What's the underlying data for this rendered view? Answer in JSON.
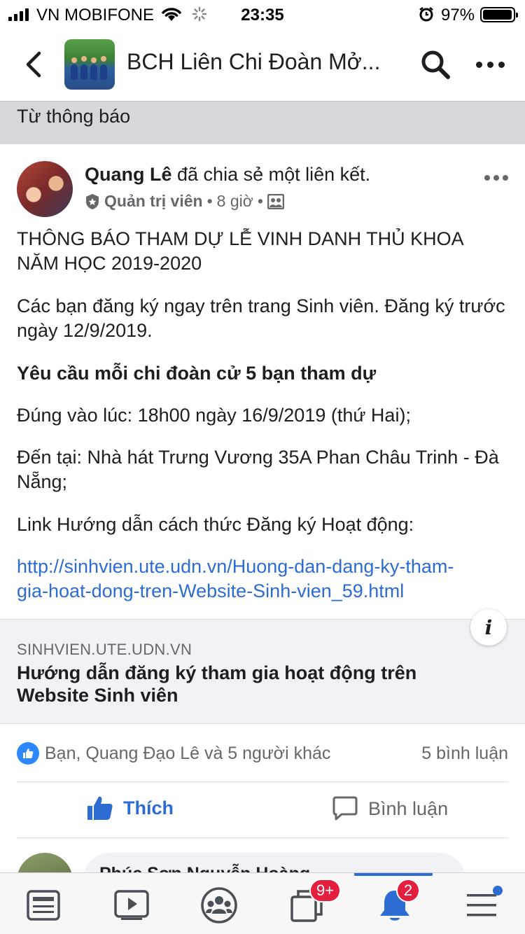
{
  "status_bar": {
    "carrier": "VN MOBIFONE",
    "time": "23:35",
    "battery": "97%",
    "battery_level": 0.97
  },
  "header": {
    "group_name": "BCH Liên Chi Đoàn Mở...",
    "search_icon": "search-icon",
    "more_icon": "more-icon"
  },
  "section_banner": "Từ thông báo",
  "post": {
    "author": "Quang Lê",
    "action": " đã chia sẻ một liên kết.",
    "role": "Quản trị viên",
    "sep1": "•",
    "time": "8 giờ",
    "sep2": "•",
    "lines": {
      "p1": "THÔNG BÁO THAM DỰ LỄ VINH DANH THỦ KHOA NĂM HỌC 2019-2020",
      "p2": "Các bạn đăng ký ngay trên trang Sinh viên. Đăng ký trước ngày 12/9/2019.",
      "p3": "Yêu cầu mỗi chi đoàn cử 5 bạn tham dự",
      "p4": "Đúng vào lúc: 18h00 ngày 16/9/2019 (thứ Hai);",
      "p5": "Đến tại: Nhà hát Trưng Vương 35A Phan Châu Trinh - Đà Nẵng;",
      "p6": "Link Hướng dẫn cách thức Đăng ký Hoạt động:",
      "url_line1": "http://sinhvien.ute.udn.vn/Huong-dan-dang-ky-tham-",
      "url_line2": "gia-hoat-dong-tren-Website-Sinh-vien_59.html"
    }
  },
  "link_preview": {
    "domain": "SINHVIEN.UTE.UDN.VN",
    "title": "Hướng dẫn đăng ký tham gia hoạt động trên Website Sinh viên",
    "info_glyph": "i"
  },
  "reactions": {
    "names": "Bạn, Quang Đạo Lê và 5 người khác",
    "comments": "5 bình luận"
  },
  "actions": {
    "like": "Thích",
    "comment": "Bình luận"
  },
  "comment_preview": {
    "author": "Phúc Sơn Nguyễn Hoàng"
  },
  "tabbar": {
    "groups_badge": "9+",
    "notifications_badge": "2"
  },
  "colors": {
    "accent": "#2d6cd2",
    "badge": "#e41e3f",
    "banner": "#d5d7db"
  }
}
